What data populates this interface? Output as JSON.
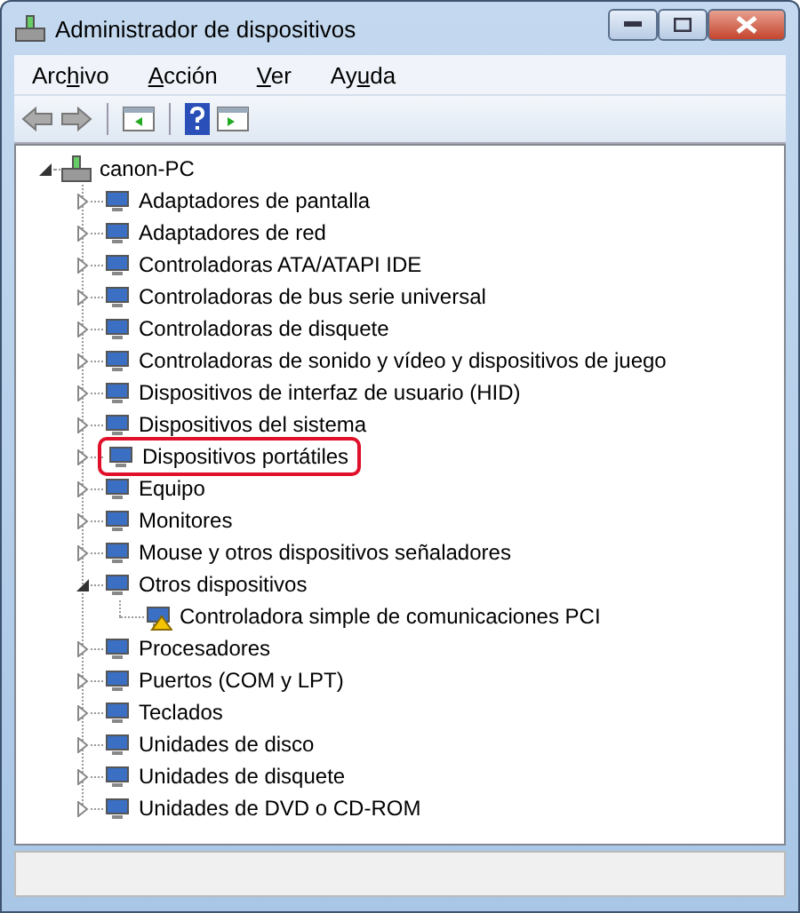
{
  "window": {
    "title": "Administrador de dispositivos"
  },
  "menu": [
    {
      "before": "Arc",
      "key": "h",
      "after": "ivo"
    },
    {
      "key": "A",
      "after": "cción"
    },
    {
      "key": "V",
      "after": "er"
    },
    {
      "before": "Ay",
      "key": "u",
      "after": "da"
    }
  ],
  "tree": {
    "label": "canon-PC",
    "expanded": true,
    "children": [
      {
        "label": "Adaptadores de pantalla",
        "expanded": false,
        "highlighted": false
      },
      {
        "label": "Adaptadores de red",
        "expanded": false,
        "highlighted": false
      },
      {
        "label": "Controladoras ATA/ATAPI IDE",
        "expanded": false,
        "highlighted": false
      },
      {
        "label": "Controladoras de bus serie universal",
        "expanded": false,
        "highlighted": false
      },
      {
        "label": "Controladoras de disquete",
        "expanded": false,
        "highlighted": false
      },
      {
        "label": "Controladoras de sonido y vídeo y dispositivos de juego",
        "expanded": false,
        "highlighted": false
      },
      {
        "label": "Dispositivos de interfaz de usuario (HID)",
        "expanded": false,
        "highlighted": false
      },
      {
        "label": "Dispositivos del sistema",
        "expanded": false,
        "highlighted": false
      },
      {
        "label": "Dispositivos portátiles",
        "expanded": false,
        "highlighted": true
      },
      {
        "label": "Equipo",
        "expanded": false,
        "highlighted": false
      },
      {
        "label": "Monitores",
        "expanded": false,
        "highlighted": false
      },
      {
        "label": "Mouse y otros dispositivos señaladores",
        "expanded": false,
        "highlighted": false
      },
      {
        "label": "Otros dispositivos",
        "expanded": true,
        "highlighted": false,
        "children": [
          {
            "label": "Controladora simple de comunicaciones PCI",
            "warning": true
          }
        ]
      },
      {
        "label": "Procesadores",
        "expanded": false,
        "highlighted": false
      },
      {
        "label": "Puertos (COM y LPT)",
        "expanded": false,
        "highlighted": false
      },
      {
        "label": "Teclados",
        "expanded": false,
        "highlighted": false
      },
      {
        "label": "Unidades de disco",
        "expanded": false,
        "highlighted": false
      },
      {
        "label": "Unidades de disquete",
        "expanded": false,
        "highlighted": false
      },
      {
        "label": "Unidades de DVD o CD-ROM",
        "expanded": false,
        "highlighted": false
      }
    ]
  }
}
